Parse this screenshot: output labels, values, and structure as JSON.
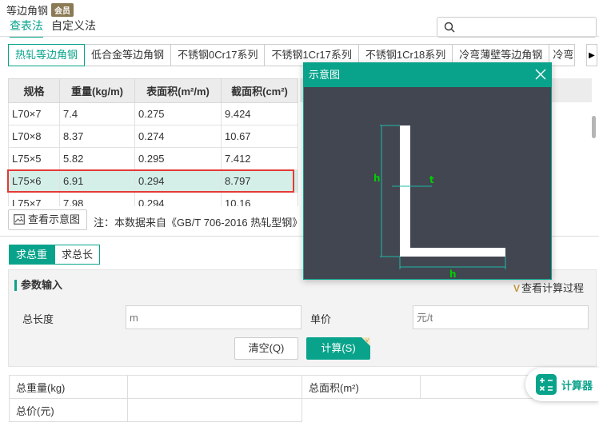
{
  "app": {
    "title": "等边角钢",
    "vip_badge": "会员"
  },
  "mode_tabs": [
    {
      "label": "查表法"
    },
    {
      "label": "自定义法"
    }
  ],
  "search": {
    "placeholder": ""
  },
  "category_tabs": [
    {
      "label": "热轧等边角钢"
    },
    {
      "label": "低合金等边角钢"
    },
    {
      "label": "不锈钢0Cr17系列"
    },
    {
      "label": "不锈钢1Cr17系列"
    },
    {
      "label": "不锈钢1Cr18系列"
    },
    {
      "label": "冷弯薄壁等边角钢"
    },
    {
      "label": "冷弯等"
    }
  ],
  "table": {
    "headers": [
      "规格",
      "重量(kg/m)",
      "表面积(m²/m)",
      "截面积(cm²)"
    ],
    "rows": [
      [
        "L70×7",
        "7.4",
        "0.275",
        "9.424"
      ],
      [
        "L70×8",
        "8.37",
        "0.274",
        "10.67"
      ],
      [
        "L75×5",
        "5.82",
        "0.295",
        "7.412"
      ],
      [
        "L75×6",
        "6.91",
        "0.294",
        "8.797"
      ],
      [
        "L75×7",
        "7.98",
        "0.294",
        "10.16"
      ]
    ],
    "selected_row": 3
  },
  "view_diagram_label": "查看示意图",
  "note": "注：本数据来自《GB/T  706-2016  热轧型钢》",
  "calc_tabs": [
    {
      "label": "求总重"
    },
    {
      "label": "求总长"
    }
  ],
  "params": {
    "title": "参数输入",
    "calc_process": "查看计算过程",
    "length_label": "总长度",
    "length_placeholder": "m",
    "price_label": "单价",
    "price_placeholder": "元/t",
    "clear_label": "清空(Q)",
    "calc_label": "计算(S)"
  },
  "results": {
    "total_weight_label": "总重量(kg)",
    "total_area_label": "总面积(m²)",
    "total_price_label": "总价(元)"
  },
  "popup": {
    "title": "示意图",
    "label_h_left": "h",
    "label_t": "t",
    "label_h_bottom": "h"
  },
  "fab": {
    "label": "计算器"
  },
  "colors": {
    "accent": "#09a38b",
    "highlight": "#e53935",
    "diagram_bg": "#424651",
    "dimension": "#00d000"
  }
}
